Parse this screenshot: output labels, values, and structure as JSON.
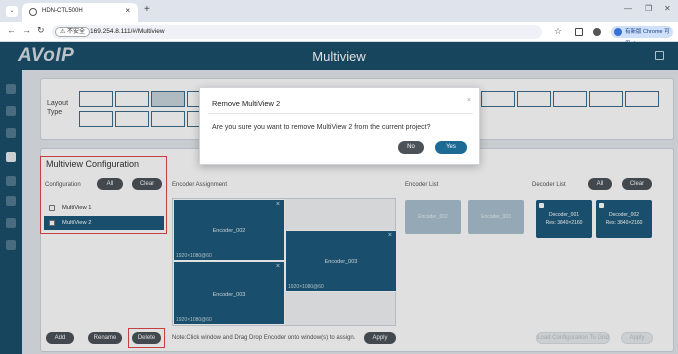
{
  "browser": {
    "tab_title": "HDN-CTL500H",
    "tab_close": "×",
    "new_tab": "+",
    "security_label": "⚠ 不安全",
    "url": "169.254.8.111/#/Multiview",
    "profile_label": "有新版 Chrome 可用 ⋮"
  },
  "app": {
    "logo": "AVoIP",
    "page_title": "Multiview"
  },
  "layout_type": {
    "label": "Layout Type"
  },
  "config": {
    "title": "Multiview Configuration",
    "configuration_label": "Configuration",
    "all_button": "All",
    "clear_button": "Clear",
    "items": [
      {
        "label": "MultiView 1",
        "selected": false
      },
      {
        "label": "MultiView 2",
        "selected": true
      }
    ]
  },
  "encoder_assignment": {
    "label": "Encoder Assignment",
    "windows": [
      {
        "name": "Encoder_002",
        "res": "1920×1080@60"
      },
      {
        "name": "Encoder_003",
        "res": "1920×1080@60"
      },
      {
        "name": "Encoder_003",
        "res": "1920×1080@60"
      }
    ]
  },
  "encoder_list": {
    "label": "Encoder List",
    "items": [
      "Encoder_002",
      "Encoder_003"
    ]
  },
  "decoder_list": {
    "label": "Decoder List",
    "all_button": "All",
    "clear_button": "Clear",
    "items": [
      {
        "name": "Decoder_001",
        "res": "Res: 3840×2160"
      },
      {
        "name": "Decoder_002",
        "res": "Res: 3840×2160"
      }
    ]
  },
  "bottom": {
    "add_button": "Add",
    "rename_button": "Rename",
    "delete_button": "Delete",
    "note": "Note:Click window and Drag Drop Encoder onto window(s) to assign.",
    "apply_button": "Apply",
    "load_config_button": "Load Configuration To Grid",
    "apply2_button": "Apply"
  },
  "modal": {
    "title": "Remove MultiView 2",
    "close": "×",
    "message": "Are you sure you want to remove MultiView 2 from the current project?",
    "no_button": "No",
    "yes_button": "Yes"
  },
  "colors": {
    "header": "#1b4f6b",
    "accent": "#1d5b7b",
    "highlight": "#e14b4b"
  }
}
